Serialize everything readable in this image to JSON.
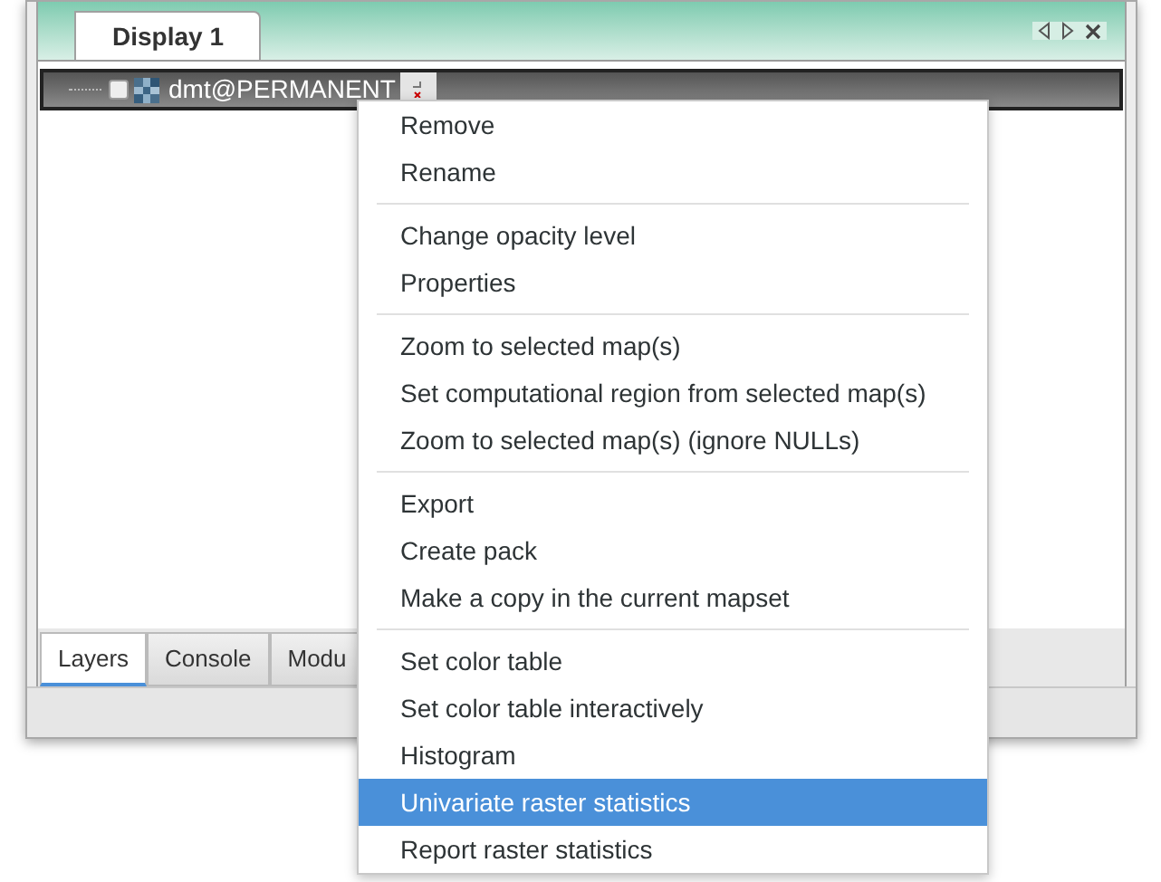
{
  "display_tabs": [
    {
      "label": "Display 1",
      "selected": true
    }
  ],
  "layer": {
    "name": "dmt@PERMANENT",
    "checked": false
  },
  "bottom_tabs": [
    {
      "label": "Layers",
      "selected": true
    },
    {
      "label": "Console",
      "selected": false
    },
    {
      "label": "Modu",
      "selected": false
    }
  ],
  "context_menu": {
    "groups": [
      [
        {
          "label": "Remove",
          "selected": false
        },
        {
          "label": "Rename",
          "selected": false
        }
      ],
      [
        {
          "label": "Change opacity level",
          "selected": false
        },
        {
          "label": "Properties",
          "selected": false
        }
      ],
      [
        {
          "label": "Zoom to selected map(s)",
          "selected": false
        },
        {
          "label": "Set computational region from selected map(s)",
          "selected": false
        },
        {
          "label": "Zoom to selected map(s) (ignore NULLs)",
          "selected": false
        }
      ],
      [
        {
          "label": "Export",
          "selected": false
        },
        {
          "label": "Create pack",
          "selected": false
        },
        {
          "label": "Make a copy in the current mapset",
          "selected": false
        }
      ],
      [
        {
          "label": "Set color table",
          "selected": false
        },
        {
          "label": "Set color table interactively",
          "selected": false
        },
        {
          "label": "Histogram",
          "selected": false
        },
        {
          "label": "Univariate raster statistics",
          "selected": true
        },
        {
          "label": "Report raster statistics",
          "selected": false
        }
      ]
    ]
  }
}
